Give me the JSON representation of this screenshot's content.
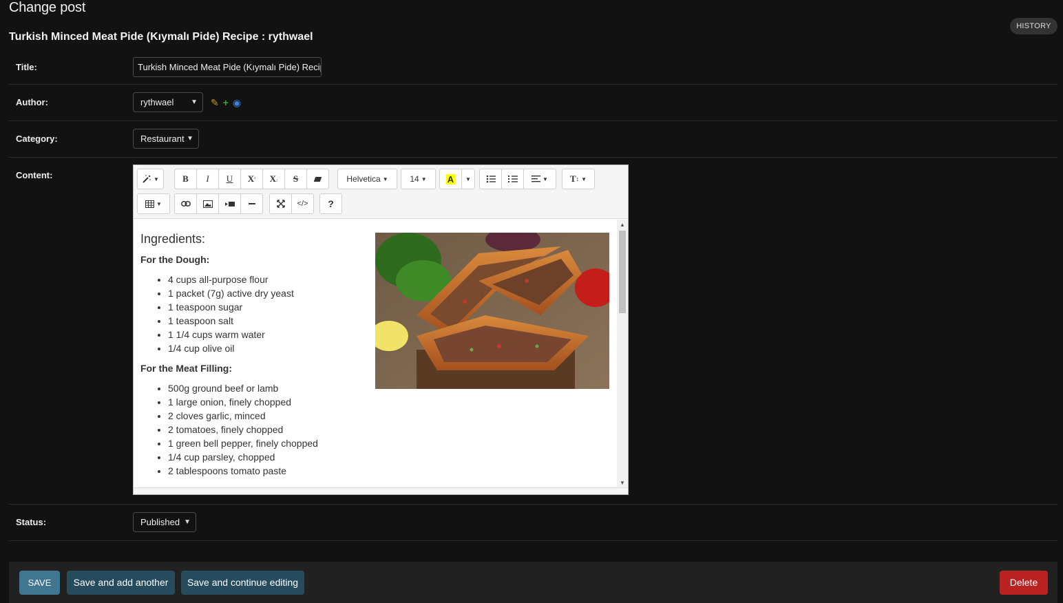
{
  "page": {
    "heading": "Change post",
    "history_label": "History",
    "object_title": "Turkish Minced Meat Pide (Kıymalı Pide) Recipe : rythwael"
  },
  "form": {
    "title_label": "Title:",
    "title_value": "Turkish Minced Meat Pide (Kıymalı Pide) Recipe",
    "author_label": "Author:",
    "author_value": "rythwael",
    "category_label": "Category:",
    "category_value": "Restaurant",
    "content_label": "Content:",
    "status_label": "Status:",
    "status_value": "Published"
  },
  "editor": {
    "font_name": "Helvetica",
    "font_size": "14",
    "highlight_letter": "A",
    "highlight_color": "#ffff00",
    "content": {
      "heading": "Ingredients:",
      "dough_heading": "For the Dough:",
      "dough_items": [
        "4 cups all-purpose flour",
        "1 packet (7g) active dry yeast",
        "1 teaspoon sugar",
        "1 teaspoon salt",
        "1 1/4 cups warm water",
        "1/4 cup olive oil"
      ],
      "filling_heading": "For the Meat Filling:",
      "filling_items": [
        "500g ground beef or lamb",
        "1 large onion, finely chopped",
        "2 cloves garlic, minced",
        "2 tomatoes, finely chopped",
        "1 green bell pepper, finely chopped",
        "1/4 cup parsley, chopped",
        "2 tablespoons tomato paste"
      ]
    }
  },
  "actions": {
    "save": "Save",
    "save_add": "Save and add another",
    "save_continue": "Save and continue editing",
    "delete": "Delete"
  },
  "colors": {
    "background": "#121212",
    "save_button": "#417690",
    "secondary_button": "#264b5d",
    "delete_button": "#ba2121"
  }
}
